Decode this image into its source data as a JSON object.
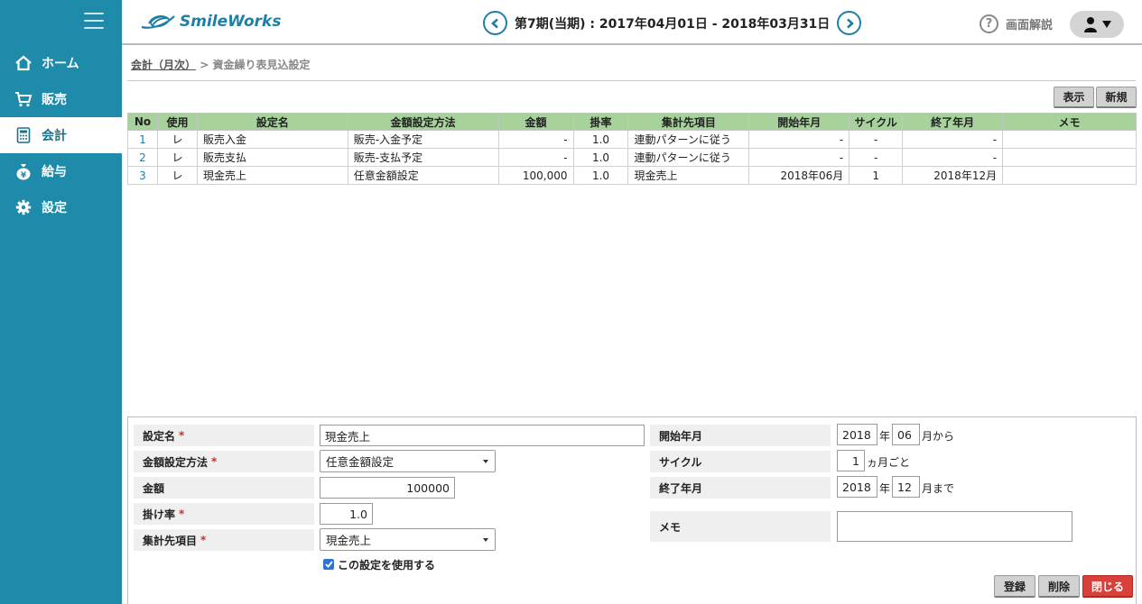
{
  "sidebar": {
    "items": [
      {
        "label": "ホーム",
        "icon": "home-icon"
      },
      {
        "label": "販売",
        "icon": "cart-icon"
      },
      {
        "label": "会計",
        "icon": "calculator-icon",
        "active": true
      },
      {
        "label": "給与",
        "icon": "yen-bag-icon"
      },
      {
        "label": "設定",
        "icon": "gear-icon"
      }
    ]
  },
  "header": {
    "logo_text": "SmileWorks",
    "period": "第7期(当期) : 2017年04月01日 - 2018年03月31日",
    "help_label": "画面解説",
    "help_glyph": "?"
  },
  "breadcrumb": {
    "parent": "会計（月次）",
    "separator": " > ",
    "current": "資金繰り表見込設定"
  },
  "toolbar": {
    "show_label": "表示",
    "new_label": "新規"
  },
  "table": {
    "columns": [
      "No",
      "使用",
      "設定名",
      "金額設定方法",
      "金額",
      "掛率",
      "集計先項目",
      "開始年月",
      "サイクル",
      "終了年月",
      "メモ"
    ],
    "rows": [
      {
        "no": "1",
        "use": "レ",
        "name": "販売入金",
        "method": "販売-入金予定",
        "amount": "-",
        "rate": "1.0",
        "target": "連動パターンに従う",
        "start": "-",
        "cycle": "-",
        "end": "-",
        "memo": ""
      },
      {
        "no": "2",
        "use": "レ",
        "name": "販売支払",
        "method": "販売-支払予定",
        "amount": "-",
        "rate": "1.0",
        "target": "連動パターンに従う",
        "start": "-",
        "cycle": "-",
        "end": "-",
        "memo": ""
      },
      {
        "no": "3",
        "use": "レ",
        "name": "現金売上",
        "method": "任意金額設定",
        "amount": "100,000",
        "rate": "1.0",
        "target": "現金売上",
        "start": "2018年06月",
        "cycle": "1",
        "end": "2018年12月",
        "memo": ""
      }
    ]
  },
  "form": {
    "name_label": "設定名",
    "name_value": "現金売上",
    "method_label": "金額設定方法",
    "method_value": "任意金額設定",
    "amount_label": "金額",
    "amount_value": "100000",
    "rate_label": "掛け率",
    "rate_value": "1.0",
    "target_label": "集計先項目",
    "target_value": "現金売上",
    "use_label": "この設定を使用する",
    "required_mark": "*",
    "start_label": "開始年月",
    "start_year": "2018",
    "year_unit": "年",
    "start_month": "06",
    "start_suffix": "月から",
    "cycle_label": "サイクル",
    "cycle_value": "1",
    "cycle_suffix": "ヵ月ごと",
    "end_label": "終了年月",
    "end_year": "2018",
    "end_month": "12",
    "end_suffix": "月まで",
    "memo_label": "メモ",
    "memo_value": ""
  },
  "actions": {
    "register_label": "登録",
    "delete_label": "削除",
    "close_label": "閉じる"
  }
}
